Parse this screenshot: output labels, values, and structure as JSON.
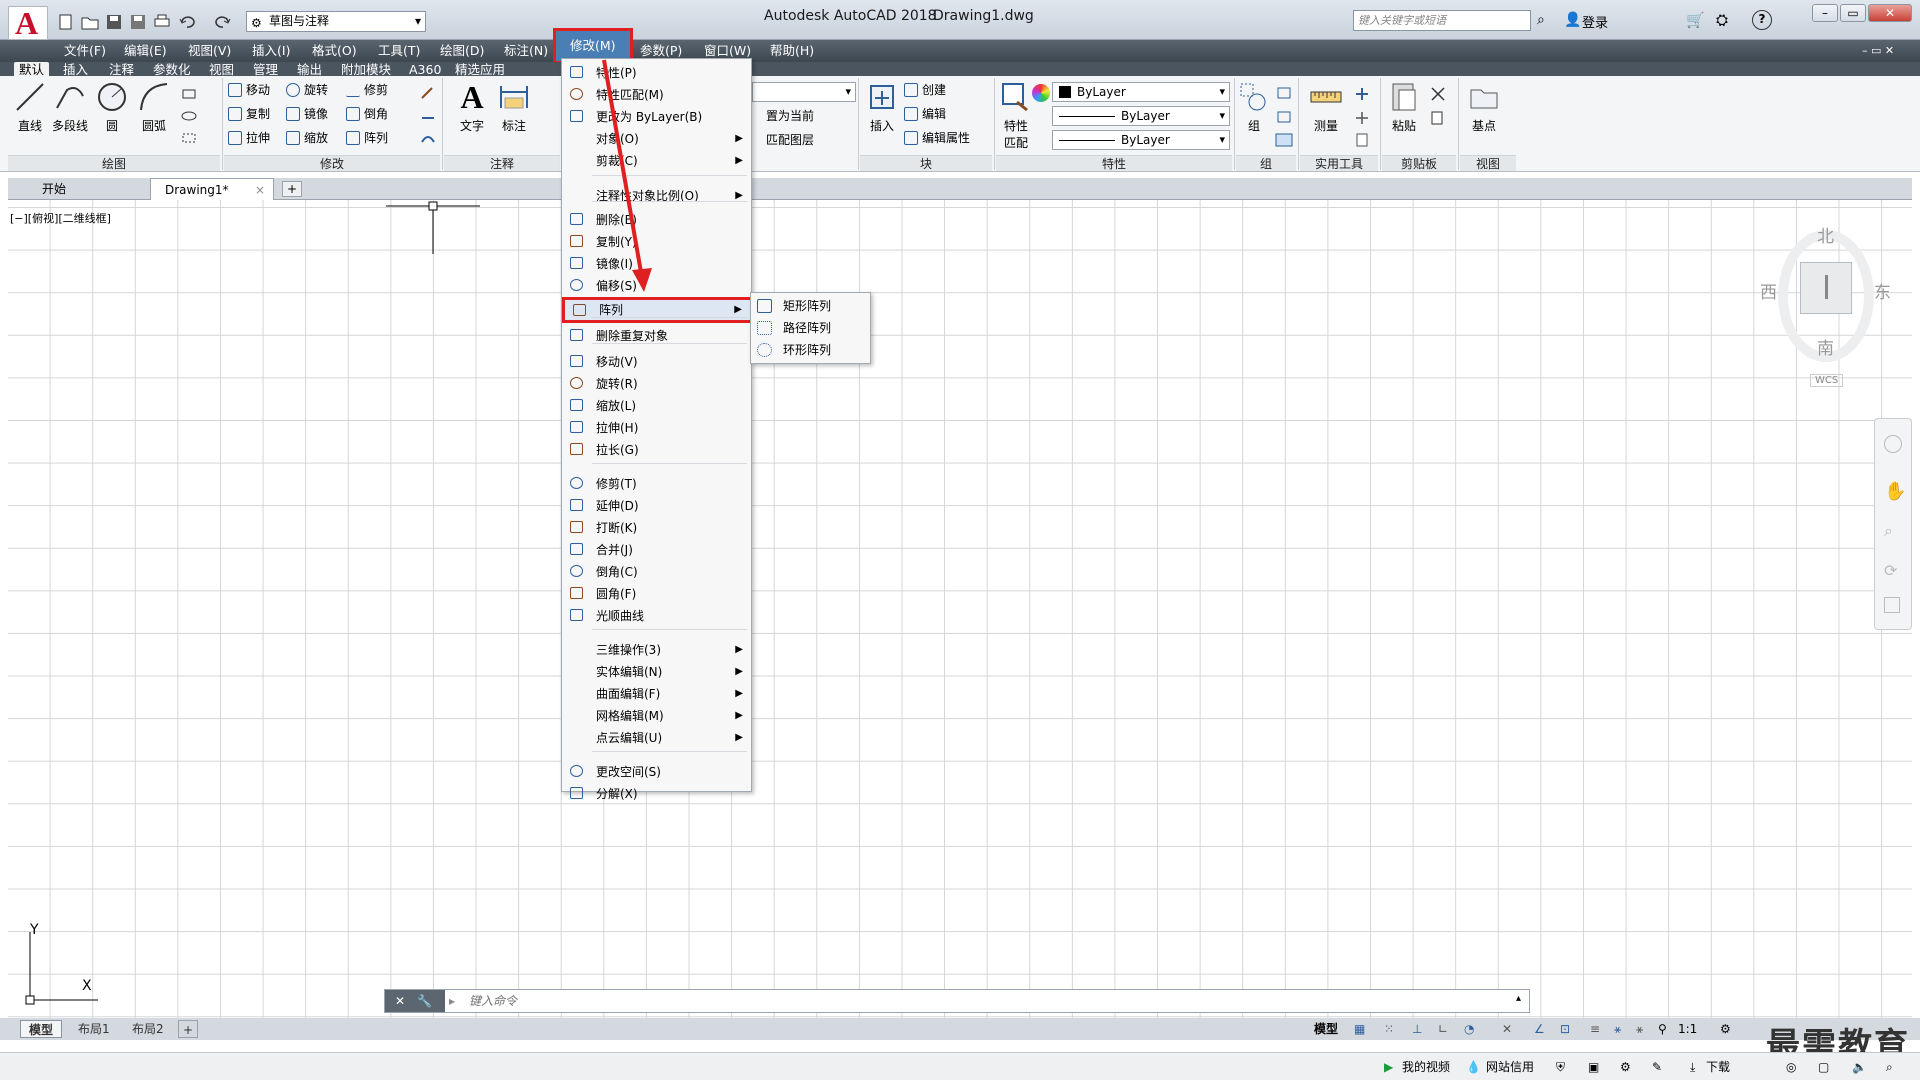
{
  "app": {
    "title": "Autodesk AutoCAD 2018",
    "document": "Drawing1.dwg",
    "logo_letter": "A"
  },
  "quick_access": {
    "workspace": "草图与注释"
  },
  "search": {
    "placeholder": "键入关键字或短语"
  },
  "user": {
    "login": "登录"
  },
  "menubar": [
    "文件(F)",
    "编辑(E)",
    "视图(V)",
    "插入(I)",
    "格式(O)",
    "工具(T)",
    "绘图(D)",
    "标注(N)",
    "修改(M)",
    "参数(P)",
    "窗口(W)",
    "帮助(H)"
  ],
  "ribbon_tabs": [
    "默认",
    "插入",
    "注释",
    "参数化",
    "视图",
    "管理",
    "输出",
    "附加模块",
    "A360",
    "精选应用"
  ],
  "ribbon": {
    "draw": {
      "title": "绘图",
      "line": "直线",
      "polyline": "多段线",
      "circle": "圆",
      "arc": "圆弧"
    },
    "modify": {
      "title": "修改",
      "move": "移动",
      "rotate": "旋转",
      "trim": "修剪",
      "copy": "复制",
      "mirror": "镜像",
      "fillet": "倒角",
      "stretch": "拉伸",
      "scale": "缩放",
      "array": "阵列"
    },
    "annotation": {
      "title": "注释",
      "text": "文字",
      "dim": "标注"
    },
    "layers": {
      "set_current": "置为当前",
      "match": "匹配图层"
    },
    "block": {
      "title": "块",
      "insert": "插入",
      "create": "创建",
      "edit": "编辑",
      "edit_attr": "编辑属性"
    },
    "properties": {
      "title": "特性",
      "match": "特性",
      "match2": "匹配",
      "color": "ByLayer",
      "linetype": "ByLayer",
      "lineweight": "ByLayer"
    },
    "groups": {
      "title": "组",
      "group": "组"
    },
    "utilities": {
      "title": "实用工具",
      "measure": "测量"
    },
    "clipboard": {
      "title": "剪贴板",
      "paste": "粘贴"
    },
    "view": {
      "title": "视图",
      "base": "基点"
    }
  },
  "file_tabs": {
    "start": "开始",
    "drawing": "Drawing1*"
  },
  "viewport": {
    "label": "[−][俯视][二维线框]"
  },
  "viewcube": {
    "north": "北",
    "south": "南",
    "east": "东",
    "west": "西",
    "wcs": "WCS"
  },
  "ucs": {
    "x": "X",
    "y": "Y"
  },
  "command": {
    "placeholder": "键入命令"
  },
  "layout_tabs": [
    "模型",
    "布局1",
    "布局2"
  ],
  "status": {
    "model": "模型",
    "scale": "1:1"
  },
  "taskbar": {
    "video": "我的视频",
    "net": "网站信用",
    "download": "下载"
  },
  "watermark": "最需教育",
  "modify_menu": [
    {
      "label": "特性(P)"
    },
    {
      "label": "特性匹配(M)"
    },
    {
      "label": "更改为 ByLayer(B)"
    },
    {
      "label": "对象(O)",
      "sub": true
    },
    {
      "label": "剪裁(C)",
      "sub": true
    },
    {
      "label": "注释性对象比例(O)",
      "sub": true
    },
    {
      "label": "删除(E)"
    },
    {
      "label": "复制(Y)"
    },
    {
      "label": "镜像(I)"
    },
    {
      "label": "偏移(S)"
    },
    {
      "label": "阵列",
      "sub": true
    },
    {
      "label": "删除重复对象"
    },
    {
      "label": "移动(V)"
    },
    {
      "label": "旋转(R)"
    },
    {
      "label": "缩放(L)"
    },
    {
      "label": "拉伸(H)"
    },
    {
      "label": "拉长(G)"
    },
    {
      "label": "修剪(T)"
    },
    {
      "label": "延伸(D)"
    },
    {
      "label": "打断(K)"
    },
    {
      "label": "合并(J)"
    },
    {
      "label": "倒角(C)"
    },
    {
      "label": "圆角(F)"
    },
    {
      "label": "光顺曲线"
    },
    {
      "label": "三维操作(3)",
      "sub": true
    },
    {
      "label": "实体编辑(N)",
      "sub": true
    },
    {
      "label": "曲面编辑(F)",
      "sub": true
    },
    {
      "label": "网格编辑(M)",
      "sub": true
    },
    {
      "label": "点云编辑(U)",
      "sub": true
    },
    {
      "label": "更改空间(S)"
    },
    {
      "label": "分解(X)"
    }
  ],
  "array_submenu": [
    "矩形阵列",
    "路径阵列",
    "环形阵列"
  ],
  "colors": {
    "highlight": "#e02020",
    "accent": "#2d5f9a",
    "menubar": "#3d4750"
  }
}
